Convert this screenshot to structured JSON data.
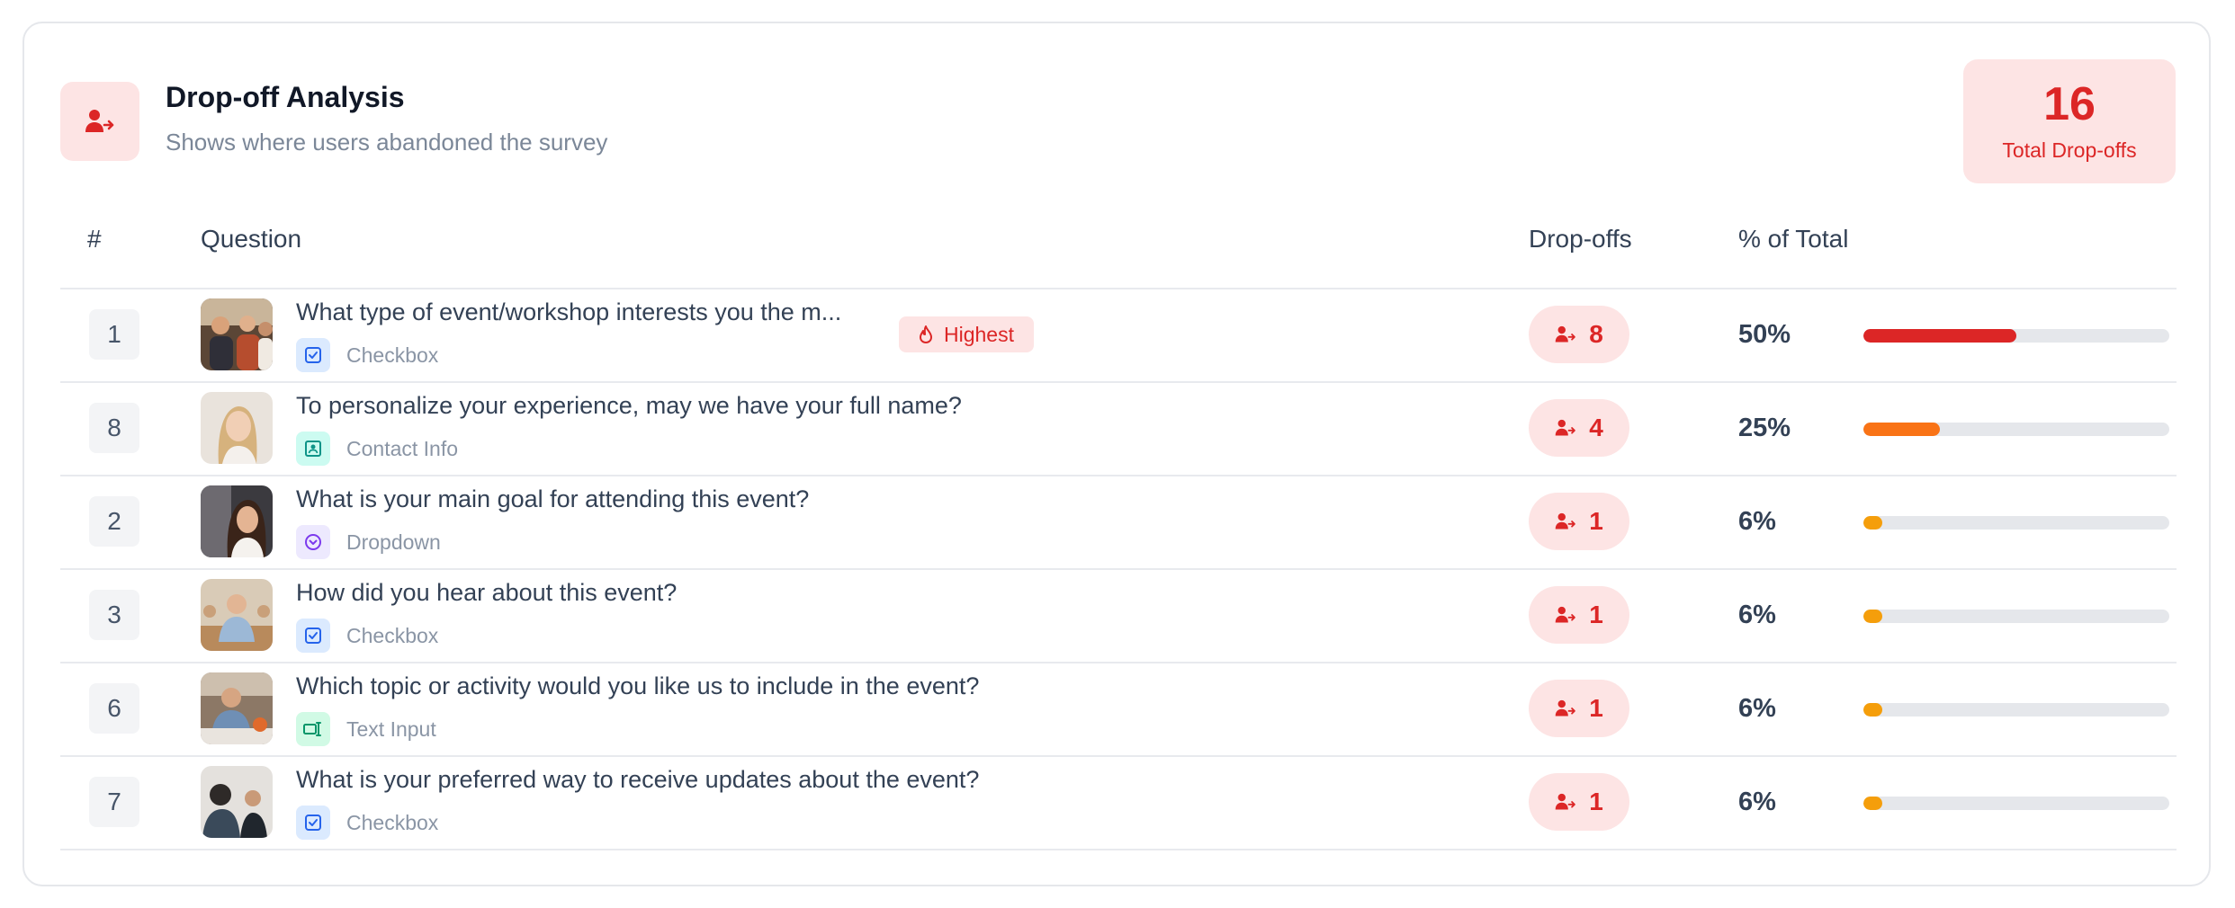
{
  "header": {
    "title": "Drop-off Analysis",
    "subtitle": "Shows where users abandoned the survey",
    "icon": "user-exit-icon"
  },
  "total": {
    "value": "16",
    "label": "Total Drop-offs"
  },
  "table": {
    "columns": [
      "#",
      "Question",
      "Drop-offs",
      "% of Total"
    ],
    "highest_badge": "Highest",
    "rows": [
      {
        "rank": "1",
        "question": "What type of event/workshop interests you the m...",
        "type": "Checkbox",
        "type_icon": "checkbox-icon",
        "dropoffs": "8",
        "percent": "50%",
        "fraction": 0.5,
        "bar_color": "#dc2626",
        "highest": true
      },
      {
        "rank": "8",
        "question": "To personalize your experience, may we have your full name?",
        "type": "Contact Info",
        "type_icon": "contact-card-icon",
        "dropoffs": "4",
        "percent": "25%",
        "fraction": 0.25,
        "bar_color": "#f97316"
      },
      {
        "rank": "2",
        "question": "What is your main goal for attending this event?",
        "type": "Dropdown",
        "type_icon": "dropdown-icon",
        "dropoffs": "1",
        "percent": "6%",
        "fraction": 0.0625,
        "bar_color": "#f59e0b"
      },
      {
        "rank": "3",
        "question": "How did you hear about this event?",
        "type": "Checkbox",
        "type_icon": "checkbox-icon",
        "dropoffs": "1",
        "percent": "6%",
        "fraction": 0.0625,
        "bar_color": "#f59e0b"
      },
      {
        "rank": "6",
        "question": "Which topic or activity would you like us to include in the event?",
        "type": "Text Input",
        "type_icon": "text-input-icon",
        "dropoffs": "1",
        "percent": "6%",
        "fraction": 0.0625,
        "bar_color": "#f59e0b"
      },
      {
        "rank": "7",
        "question": "What is your preferred way to receive updates about the event?",
        "type": "Checkbox",
        "type_icon": "checkbox-icon",
        "dropoffs": "1",
        "percent": "6%",
        "fraction": 0.0625,
        "bar_color": "#f59e0b"
      }
    ]
  }
}
